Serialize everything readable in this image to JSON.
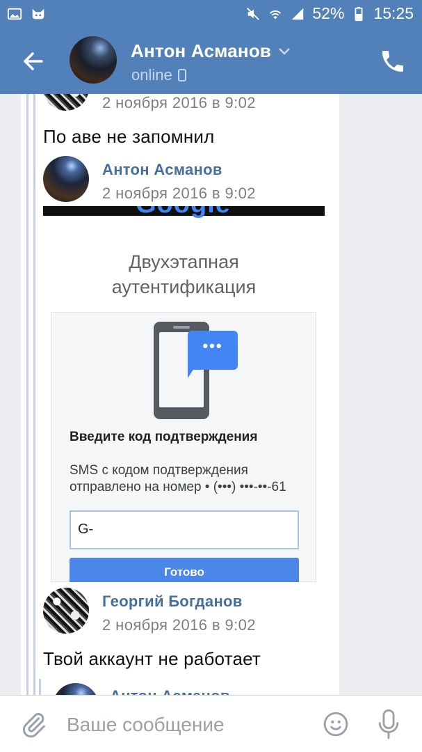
{
  "status_bar": {
    "battery": "52%",
    "time": "15:25",
    "icons": [
      "image-icon",
      "cat-icon",
      "mute-icon",
      "wifi-icon",
      "signal-icon",
      "battery-icon"
    ]
  },
  "header": {
    "contact_name": "Антон Асманов",
    "contact_status": "online",
    "icons": [
      "back-arrow-icon",
      "chevron-down-icon",
      "mobile-icon",
      "phone-icon"
    ]
  },
  "messages": [
    {
      "author": "",
      "date": "2 ноября 2016 в 9:02",
      "text": "По аве не запомнил"
    },
    {
      "author": "Антон Асманов",
      "date": "2 ноября 2016 в 9:02",
      "attachment": {
        "logo": "Google",
        "title_line1": "Двухэтапная",
        "title_line2": "аутентификация",
        "heading": "Введите код подтверждения",
        "body_line1": "SMS с кодом подтверждения",
        "body_line2": "отправлено на номер • (•••) •••-••-61",
        "input_value": "G-",
        "button": "Готово"
      }
    },
    {
      "author": "Георгий Богданов",
      "date": "2 ноября 2016 в 9:02",
      "text": "Твой аккаунт не работает"
    },
    {
      "author": "Антон Асманов"
    }
  ],
  "composer": {
    "placeholder": "Ваше сообщение",
    "icons": [
      "attach-icon",
      "emoji-icon",
      "mic-icon"
    ]
  },
  "colors": {
    "header_bg": "#5181b8",
    "author": "#466f9e",
    "google_blue": "#4285f4",
    "page_bg": "#ebedf0"
  }
}
